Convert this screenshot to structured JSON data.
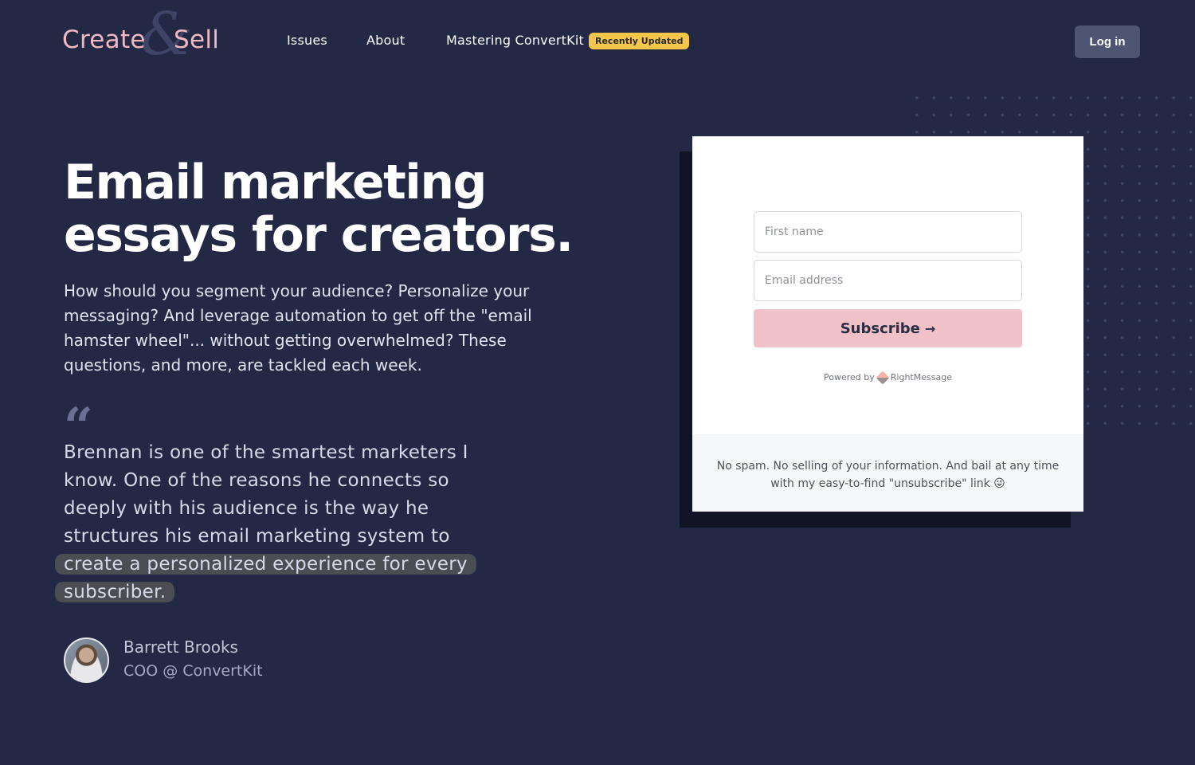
{
  "header": {
    "logo": {
      "left": "Create",
      "amp": "&",
      "right": "Sell"
    },
    "nav": [
      {
        "label": "Issues"
      },
      {
        "label": "About"
      },
      {
        "label": "Mastering ConvertKit",
        "badge": "Recently Updated"
      }
    ],
    "login_label": "Log in"
  },
  "hero": {
    "title_line1": "Email marketing",
    "title_line2": "essays for creators.",
    "description": "How should you segment your audience? Personalize your messaging? And leverage automation to get off the \"email hamster wheel\"... without getting overwhelmed? These questions, and more, are tackled each week."
  },
  "testimonial": {
    "quote_mark": "“",
    "text_plain": "Brennan is one of the smartest marketers I know. One of the reasons he connects so deeply with his audience is the way he structures his email marketing system to ",
    "text_highlight": "create a personalized experience for every subscriber.",
    "author_name": "Barrett Brooks",
    "author_role": "COO @ ConvertKit"
  },
  "form": {
    "first_name_placeholder": "First name",
    "email_placeholder": "Email address",
    "subscribe_label": "Subscribe",
    "subscribe_arrow": "→",
    "powered_prefix": "Powered by",
    "powered_brand": "RightMessage",
    "footer_text": "No spam. No selling of your information. And bail at any time with my easy-to-find \"unsubscribe\" link 😜"
  },
  "colors": {
    "background": "#232844",
    "logo_pink": "#f0b8c2",
    "badge_yellow": "#f6c64a",
    "button_pink": "#f0c2c8",
    "login_bg": "#4d5572"
  },
  "icons": {
    "quote": "quote-icon",
    "powered_brand": "rightmessage-icon",
    "subscribe_arrow": "arrow-right-icon"
  }
}
